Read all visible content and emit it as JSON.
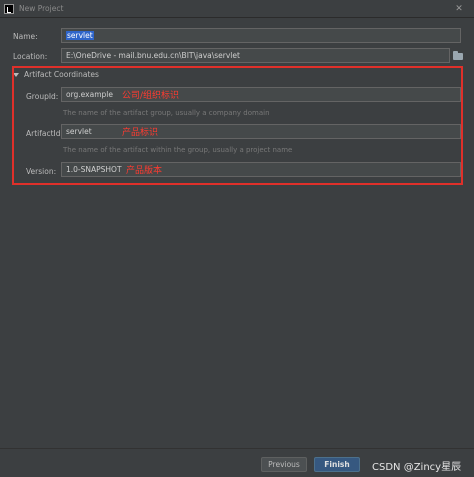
{
  "window": {
    "title": "New Project",
    "controls": {
      "close": "✕"
    }
  },
  "form": {
    "name_label": "Name:",
    "name_value": "servlet",
    "location_label": "Location:",
    "location_value": "E:\\OneDrive - mail.bnu.edu.cn\\BIT\\java\\servlet"
  },
  "artifact": {
    "section_title": "Artifact Coordinates",
    "group_label": "GroupId:",
    "group_value": "org.example",
    "group_annotation": "公司/组织标识",
    "group_hint": "The name of the artifact group, usually a company domain",
    "artifact_label": "ArtifactId:",
    "artifact_value": "servlet",
    "artifact_annotation": "产品标识",
    "artifact_hint": "The name of the artifact within the group, usually a project name",
    "version_label": "Version:",
    "version_value": "1.0-SNAPSHOT",
    "version_annotation": "产品版本"
  },
  "footer": {
    "previous_label": "Previous",
    "finish_label": "Finish",
    "watermark": "CSDN @Zincy星辰"
  },
  "colors": {
    "accent": "#365880",
    "annotation": "#ff3b30",
    "selection": "#2f65ca"
  }
}
